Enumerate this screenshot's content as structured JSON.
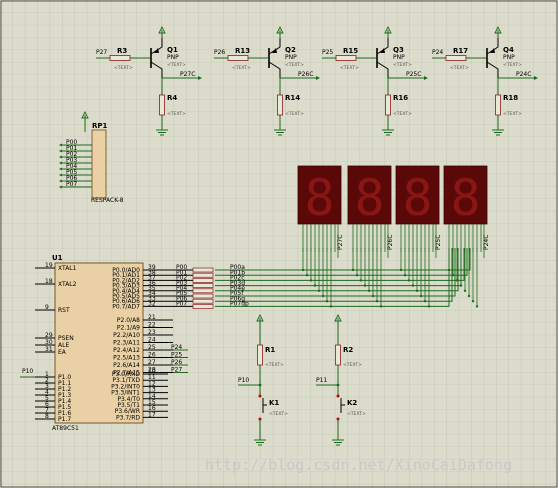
{
  "text_placeholder": "<TEXT>",
  "transistors": [
    {
      "base_net": "P27",
      "res": "R3",
      "q": "Q1",
      "type": "PNP",
      "out": "P27C",
      "pull": "R4"
    },
    {
      "base_net": "P26",
      "res": "R13",
      "q": "Q2",
      "type": "PNP",
      "out": "P26C",
      "pull": "R14"
    },
    {
      "base_net": "P25",
      "res": "R15",
      "q": "Q3",
      "type": "PNP",
      "out": "P25C",
      "pull": "R16"
    },
    {
      "base_net": "P24",
      "res": "R17",
      "q": "Q4",
      "type": "PNP",
      "out": "P24C",
      "pull": "R18"
    }
  ],
  "rp1": {
    "ref": "RP1",
    "part": "RESPACK-8",
    "pins": [
      "P00",
      "P01",
      "P02",
      "P03",
      "P04",
      "P05",
      "P06",
      "P07"
    ]
  },
  "displays": {
    "digit": "8",
    "commons": [
      "P27C",
      "P26C",
      "P25C",
      "P24C"
    ]
  },
  "mcu": {
    "ref": "U1",
    "part": "AT89C51",
    "left_pins": [
      {
        "n": "19",
        "name": "XTAL1"
      },
      {
        "n": "18",
        "name": "XTAL2"
      },
      {
        "n": "9",
        "name": "RST"
      },
      {
        "n": "29",
        "name": "PSEN"
      },
      {
        "n": "30",
        "name": "ALE"
      },
      {
        "n": "31",
        "name": "EA"
      }
    ],
    "p1_pins": [
      {
        "n": "1",
        "name": "P1.0"
      },
      {
        "n": "2",
        "name": "P1.1"
      },
      {
        "n": "3",
        "name": "P1.2"
      },
      {
        "n": "4",
        "name": "P1.3"
      },
      {
        "n": "5",
        "name": "P1.4"
      },
      {
        "n": "6",
        "name": "P1.5"
      },
      {
        "n": "7",
        "name": "P1.6"
      },
      {
        "n": "8",
        "name": "P1.7"
      }
    ],
    "p0_pins": [
      {
        "n": "39",
        "name": "P0.0/AD0"
      },
      {
        "n": "38",
        "name": "P0.1/AD1"
      },
      {
        "n": "37",
        "name": "P0.2/AD2"
      },
      {
        "n": "36",
        "name": "P0.3/AD3"
      },
      {
        "n": "35",
        "name": "P0.4/AD4"
      },
      {
        "n": "34",
        "name": "P0.5/AD5"
      },
      {
        "n": "33",
        "name": "P0.6/AD6"
      },
      {
        "n": "32",
        "name": "P0.7/AD7"
      }
    ],
    "p2_pins": [
      {
        "n": "21",
        "name": "P2.0/A8"
      },
      {
        "n": "22",
        "name": "P2.1/A9"
      },
      {
        "n": "23",
        "name": "P2.2/A10"
      },
      {
        "n": "24",
        "name": "P2.3/A11"
      },
      {
        "n": "25",
        "name": "P2.4/A12"
      },
      {
        "n": "26",
        "name": "P2.5/A13"
      },
      {
        "n": "27",
        "name": "P2.6/A14"
      },
      {
        "n": "28",
        "name": "P2.7/A15"
      }
    ],
    "p3_pins": [
      {
        "n": "10",
        "name": "P3.0/RXD"
      },
      {
        "n": "11",
        "name": "P3.1/TXD"
      },
      {
        "n": "12",
        "name": "P3.2/INT0"
      },
      {
        "n": "13",
        "name": "P3.3/INT1"
      },
      {
        "n": "14",
        "name": "P3.4/T0"
      },
      {
        "n": "15",
        "name": "P3.5/T1"
      },
      {
        "n": "16",
        "name": "P3.6/WR"
      },
      {
        "n": "17",
        "name": "P3.7/RD"
      }
    ],
    "p2_nets": [
      "",
      "",
      "",
      "",
      "P24",
      "P25",
      "P26",
      "P27"
    ],
    "p1_net": "P10",
    "p0_nets": [
      "P00",
      "P01",
      "P02",
      "P03",
      "P04",
      "P05",
      "P06",
      "P07"
    ],
    "seg_nets": [
      "P00a",
      "P01b",
      "P02c",
      "P03d",
      "P04e",
      "P05f",
      "P06g",
      "P07dp"
    ]
  },
  "keys": [
    {
      "r": "R1",
      "k": "K1",
      "net": "P10"
    },
    {
      "r": "R2",
      "k": "K2",
      "net": "P11"
    }
  ],
  "watermark": "http://blog.csdn.net/XinoCaiDafong"
}
